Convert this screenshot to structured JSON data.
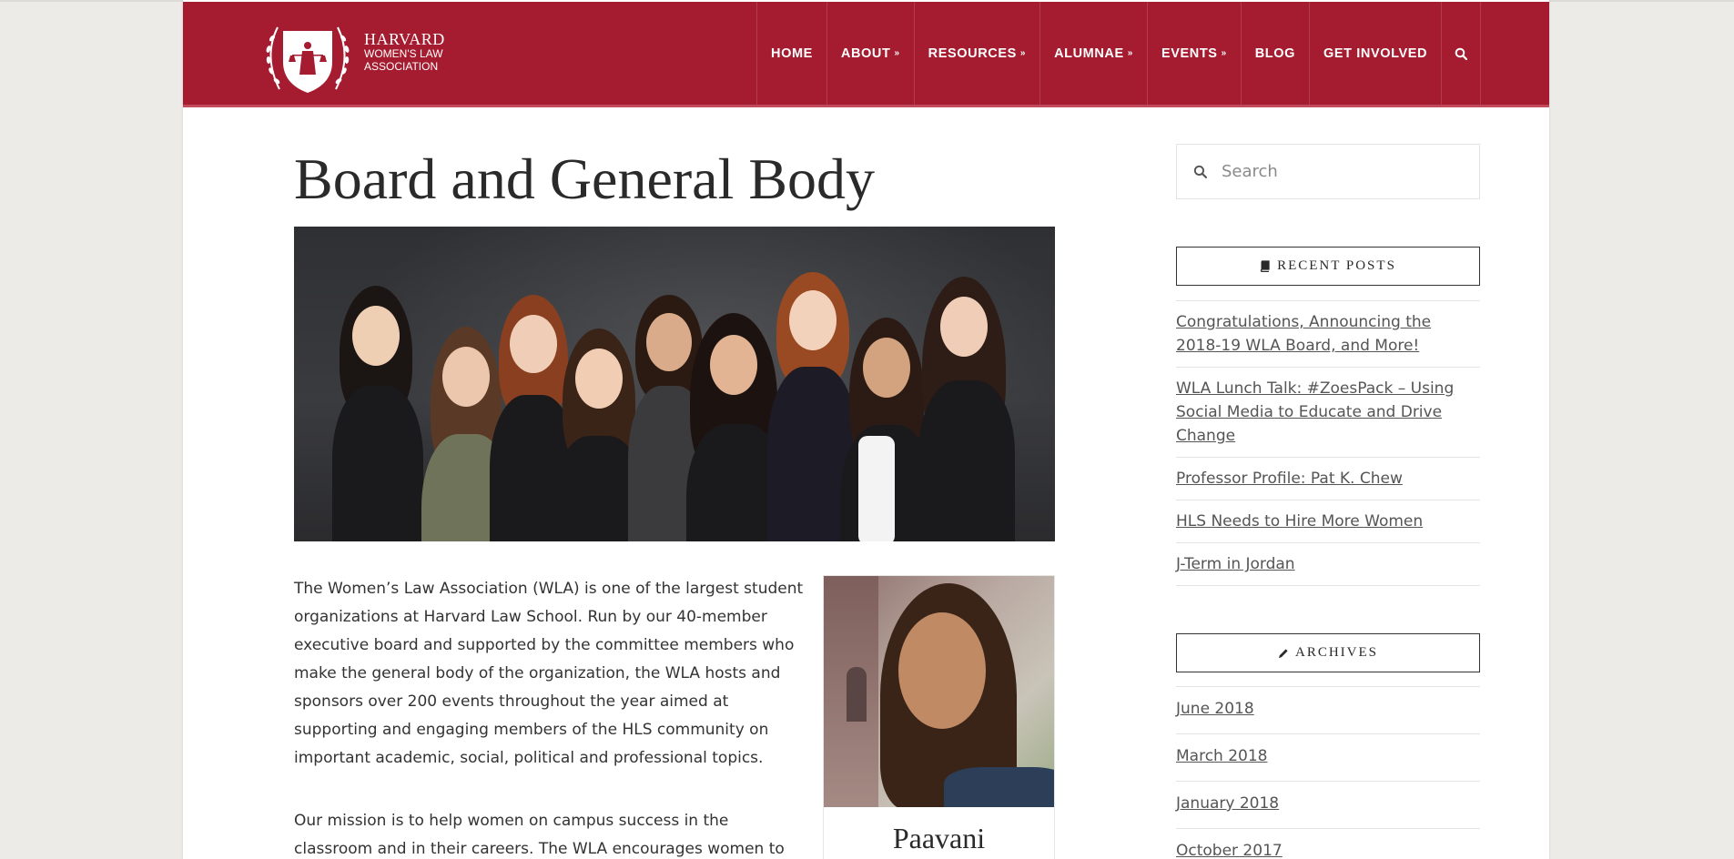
{
  "brand": {
    "line1": "HARVARD",
    "line2": "WOMEN'S LAW",
    "line3": "ASSOCIATION",
    "color": "#a51c30"
  },
  "nav": {
    "items": [
      {
        "label": "HOME",
        "has_dropdown": false
      },
      {
        "label": "ABOUT",
        "has_dropdown": true
      },
      {
        "label": "RESOURCES",
        "has_dropdown": true
      },
      {
        "label": "ALUMNAE",
        "has_dropdown": true
      },
      {
        "label": "EVENTS",
        "has_dropdown": true
      },
      {
        "label": "BLOG",
        "has_dropdown": false
      },
      {
        "label": "GET INVOLVED",
        "has_dropdown": false
      }
    ],
    "search_icon": "search-icon",
    "dropdown_icon": "double-chevron-down-icon"
  },
  "page": {
    "title": "Board and General Body",
    "intro": "The Women’s Law Association (WLA) is one of the largest student organizations at Harvard Law School. Run by our 40-member executive board and supported by the committee members who make the general body of the organization, the WLA hosts and sponsors over 200 events throughout the year aimed at supporting and engaging members of the HLS community on important academic, social, political and professional topics.",
    "mission": "Our mission is to help women on campus success in the classroom and in their careers. The WLA encourages women to make positive",
    "profile_name": "Paavani"
  },
  "sidebar": {
    "search_placeholder": "Search",
    "recent_posts_title": "RECENT POSTS",
    "recent_posts_icon": "book-icon",
    "recent_posts": [
      "Congratulations, Announcing the 2018-19 WLA Board, and More!",
      "WLA Lunch Talk: #ZoesPack – Using Social Media to Educate and Drive Change",
      "Professor Profile: Pat K. Chew",
      "HLS Needs to Hire More Women",
      "J-Term in Jordan"
    ],
    "archives_title": "ARCHIVES",
    "archives_icon": "pencil-icon",
    "archives": [
      "June 2018",
      "March 2018",
      "January 2018",
      "October 2017"
    ]
  }
}
